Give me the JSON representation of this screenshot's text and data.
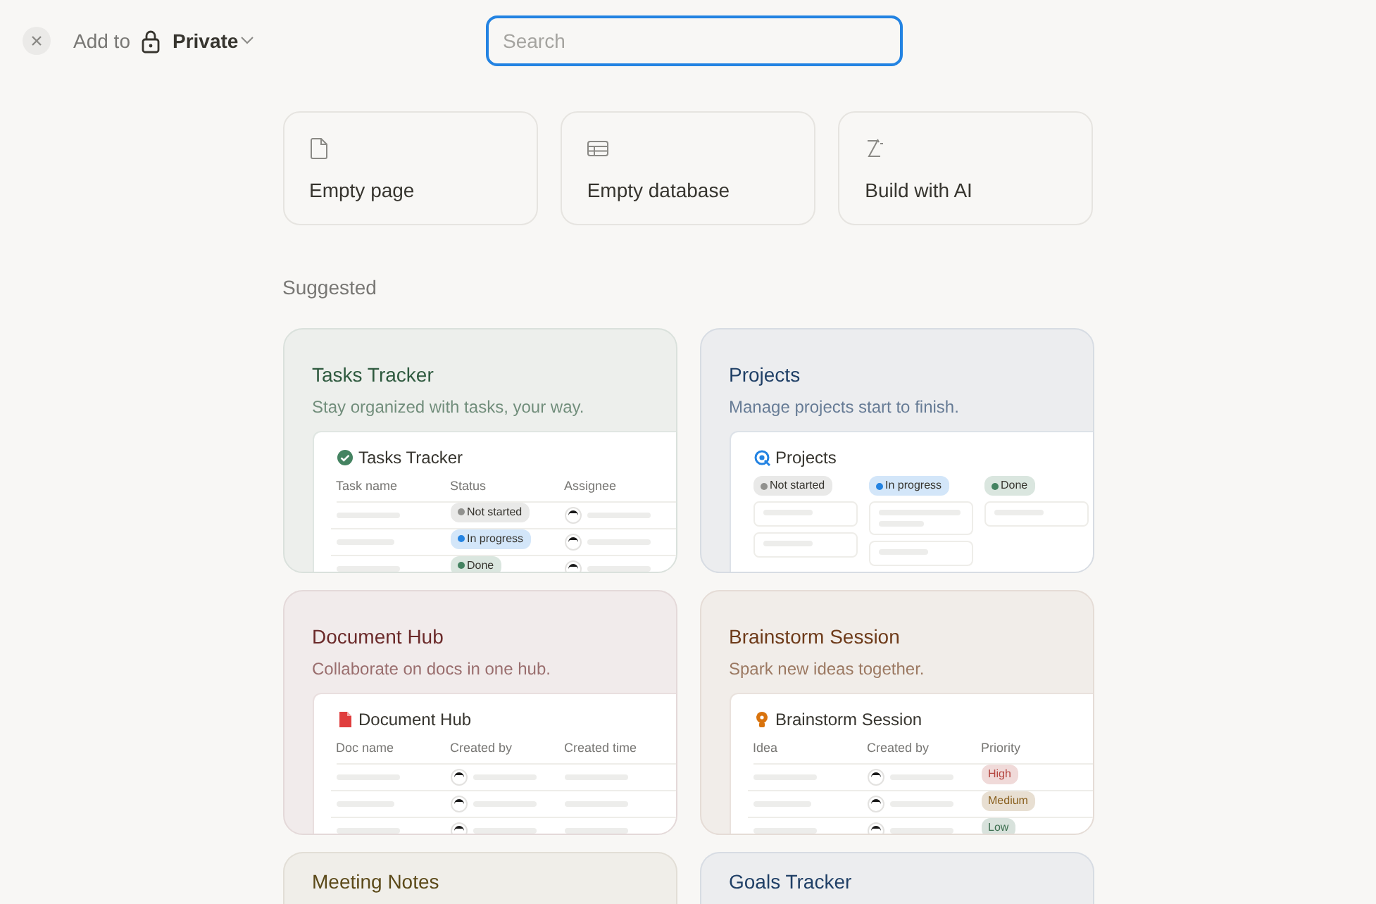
{
  "header": {
    "label": "Add to",
    "workspace": "Private",
    "search": {
      "placeholder": "Search"
    }
  },
  "quick_actions": [
    {
      "kind": "page",
      "label": "Empty page"
    },
    {
      "kind": "database",
      "label": "Empty database"
    },
    {
      "kind": "ai",
      "label": "Build with AI"
    }
  ],
  "section_title": "Suggested",
  "templates": [
    {
      "title": "Tasks Tracker",
      "description": "Stay organized with tasks, your way.",
      "color": "#2f5a3f",
      "preview": {
        "kind": "table",
        "title": "Tasks Tracker",
        "columns": [
          "Task name",
          "Status",
          "Assignee"
        ],
        "rows": [
          [
            {
              "kind": "line"
            },
            {
              "kind": "tag",
              "dot": true,
              "label": "Not started",
              "color": "#91918e"
            },
            {
              "kind": "person"
            }
          ],
          [
            {
              "kind": "line"
            },
            {
              "kind": "tag",
              "dot": true,
              "label": "In progress",
              "color": "#2383e2"
            },
            {
              "kind": "person"
            }
          ],
          [
            {
              "kind": "line"
            },
            {
              "kind": "tag",
              "dot": true,
              "label": "Done",
              "color": "#448361"
            },
            {
              "kind": "person"
            }
          ]
        ]
      }
    },
    {
      "title": "Projects",
      "description": "Manage projects start to finish.",
      "color": "#1f3f66",
      "preview": {
        "kind": "board",
        "title": "Projects",
        "groups": [
          {
            "label": "Not started",
            "dot": true,
            "color": "#91918e",
            "cards": [
              {
                "kind": "short"
              },
              {
                "kind": "short"
              }
            ]
          },
          {
            "label": "In progress",
            "dot": true,
            "color": "#2383e2",
            "cards": [
              {
                "kind": "double"
              },
              {
                "kind": "short"
              }
            ]
          },
          {
            "label": "Done",
            "dot": true,
            "color": "#448361",
            "cards": [
              {
                "kind": "short"
              }
            ]
          }
        ]
      }
    },
    {
      "title": "Document Hub",
      "description": "Collaborate on docs in one hub.",
      "color": "#6b2a2a",
      "preview": {
        "kind": "table",
        "title": "Document Hub",
        "columns": [
          "Doc name",
          "Created by",
          "Created time"
        ],
        "rows": [
          [
            {
              "kind": "line"
            },
            {
              "kind": "person"
            },
            {
              "kind": "line"
            }
          ],
          [
            {
              "kind": "line"
            },
            {
              "kind": "person"
            },
            {
              "kind": "line"
            }
          ],
          [
            {
              "kind": "line"
            },
            {
              "kind": "person"
            },
            {
              "kind": "line"
            }
          ]
        ]
      }
    },
    {
      "title": "Brainstorm Session",
      "description": "Spark new ideas together.",
      "color": "#6e3b1a",
      "preview": {
        "kind": "table",
        "title": "Brainstorm Session",
        "columns": [
          "Idea",
          "Created by",
          "Priority"
        ],
        "rows": [
          [
            {
              "kind": "line"
            },
            {
              "kind": "person"
            },
            {
              "kind": "tag",
              "dot": false,
              "label": "High",
              "color": "#b4453f"
            }
          ],
          [
            {
              "kind": "line"
            },
            {
              "kind": "person"
            },
            {
              "kind": "tag",
              "dot": false,
              "label": "Medium",
              "color": "#8a6120"
            }
          ],
          [
            {
              "kind": "line"
            },
            {
              "kind": "person"
            },
            {
              "kind": "tag",
              "dot": false,
              "label": "Low",
              "color": "#3c6e4f"
            }
          ]
        ]
      }
    },
    {
      "title": "Meeting Notes",
      "color": "#5c4a1a"
    },
    {
      "title": "Goals Tracker",
      "color": "#1f3f66"
    }
  ]
}
